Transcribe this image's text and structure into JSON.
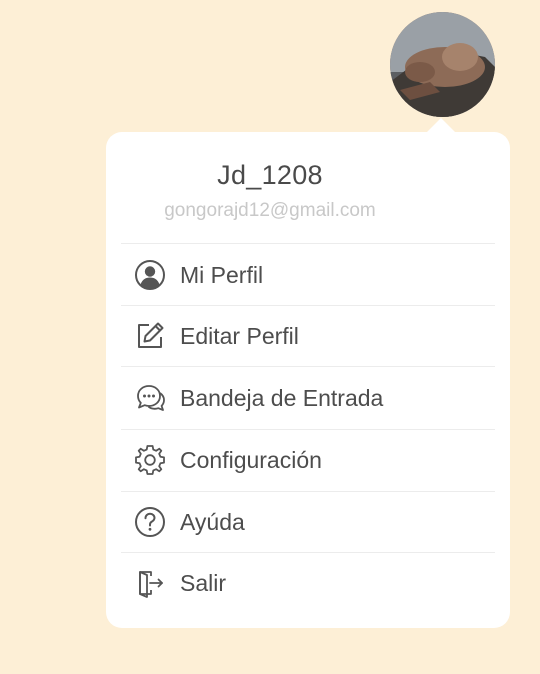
{
  "user": {
    "name": "Jd_1208",
    "email": "gongorajd12@gmail.com"
  },
  "menu": {
    "items": [
      {
        "label": "Mi Perfil",
        "icon": "user-circle-icon"
      },
      {
        "label": "Editar Perfil",
        "icon": "edit-icon"
      },
      {
        "label": "Bandeja de Entrada",
        "icon": "chat-bubbles-icon"
      },
      {
        "label": "Configuración",
        "icon": "gear-icon"
      },
      {
        "label": "Ayúda",
        "icon": "help-circle-icon"
      },
      {
        "label": "Salir",
        "icon": "exit-door-icon"
      }
    ]
  },
  "colors": {
    "background": "#fdefd6",
    "card": "#ffffff",
    "text": "#4d4d4d",
    "muted": "#c8c8c8"
  }
}
